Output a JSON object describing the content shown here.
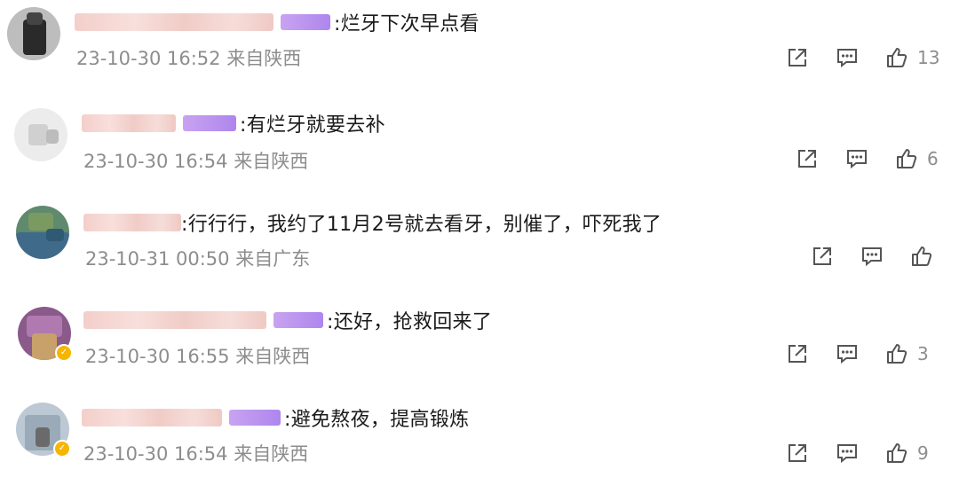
{
  "comments": [
    {
      "text": ":烂牙下次早点看",
      "timestamp": "23-10-30 16:52",
      "location": "来自陕西",
      "likes": "13"
    },
    {
      "text": ":有烂牙就要去补",
      "timestamp": "23-10-30 16:54",
      "location": "来自陕西",
      "likes": "6"
    },
    {
      "text": ":行行行，我约了11月2号就去看牙，别催了，吓死我了",
      "timestamp": "23-10-31 00:50",
      "location": "来自广东",
      "likes": ""
    },
    {
      "text": ":还好，抢救回来了",
      "timestamp": "23-10-30 16:55",
      "location": "来自陕西",
      "likes": "3"
    },
    {
      "text": ":避免熬夜，提高锻炼",
      "timestamp": "23-10-30 16:54",
      "location": "来自陕西",
      "likes": "9"
    }
  ],
  "icons": {
    "share": "share-icon",
    "reply": "comment-icon",
    "like": "thumbs-up-icon"
  },
  "colors": {
    "meta_text": "#8d8d8d",
    "badge_purple": "#ad86ee",
    "verified_badge": "#f6b600"
  }
}
